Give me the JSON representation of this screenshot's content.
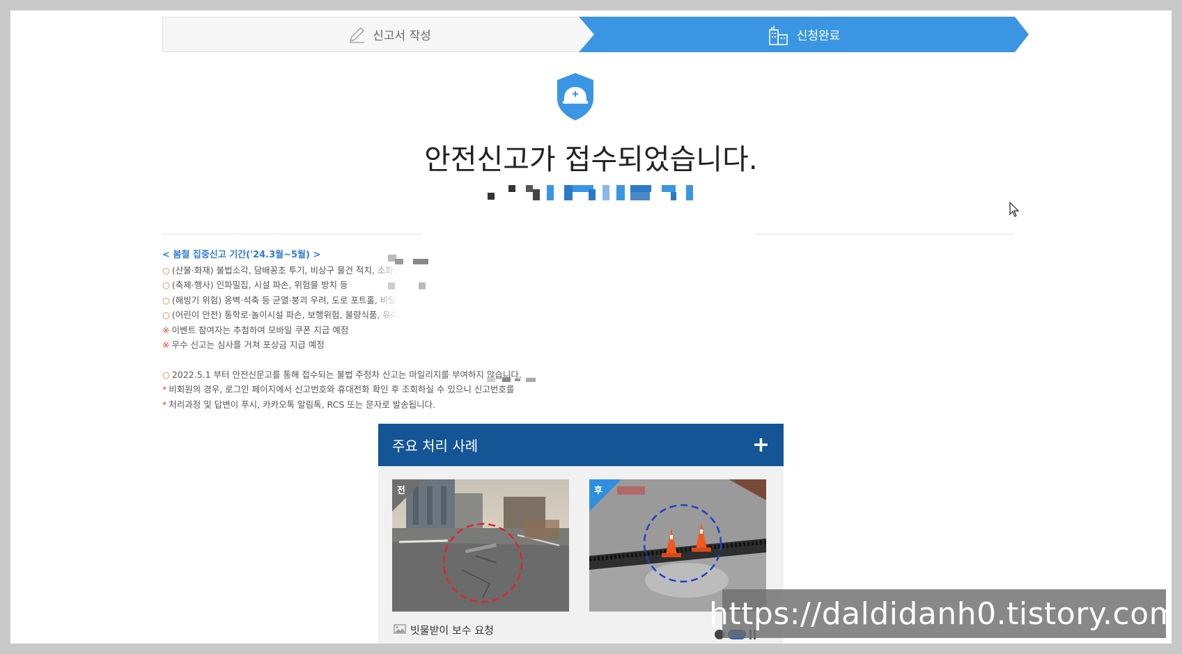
{
  "steps": [
    {
      "label": "신고서 작성",
      "icon": "pencil-icon",
      "state": "done"
    },
    {
      "label": "신청완료",
      "icon": "building-icon",
      "state": "active"
    }
  ],
  "colors": {
    "accent": "#3a96e3",
    "header_blue": "#145596",
    "notice_title": "#2e7bd4"
  },
  "headline": "안전신고가 접수되었습니다.",
  "notice": {
    "title": "< 봄철 집중신고 기간('24.3월~5월) >",
    "items": [
      {
        "bullet": "○",
        "text": "(산불·화재) 불법소각, 담배꽁초 투기, 비상구 물건 적치, 소화설비"
      },
      {
        "bullet": "○",
        "text": "(축제·행사) 인파밀집, 시설 파손, 위험물 방치 등"
      },
      {
        "bullet": "○",
        "text": "(해빙기 위험) 옹벽·석축 등 균열·붕괴 우려, 도로 포트홀, 비탈면"
      },
      {
        "bullet": "○",
        "text": "(어린이 안전) 통학로·놀이시설 파손, 보행위험, 불량식품, 유해환경"
      },
      {
        "bullet": "※",
        "text": "이벤트 참여자는 추첨하여 모바일 쿠폰 지급 예정"
      },
      {
        "bullet": "※",
        "text": "우수 신고는 심사를 거쳐 포상금 지급 예정"
      }
    ],
    "footer": [
      {
        "bullet": "○",
        "text": "2022.5.1 부터 안전신문고를 통해 접수되는 불법 주정차 신고는 마일리지를 부여하지 않습니다."
      },
      {
        "bullet": "*",
        "text": "비회원의 경우, 로그인 페이지에서 신고번호와 휴대전화 확인 후 조회하실 수 있으니 신고번호를"
      },
      {
        "bullet": "*",
        "text": "처리과정 및 답변이 푸시, 카카오톡 알림톡, RCS 또는 문자로 발송됩니다."
      }
    ]
  },
  "cases": {
    "title": "주요 처리 사례",
    "expand_label": "+",
    "before_label": "전",
    "after_label": "후",
    "caption": "빗물받이 보수 요청",
    "slide_count": 2,
    "active_slide": 2
  },
  "watermark": "https://daldidanh0.tistory.com"
}
